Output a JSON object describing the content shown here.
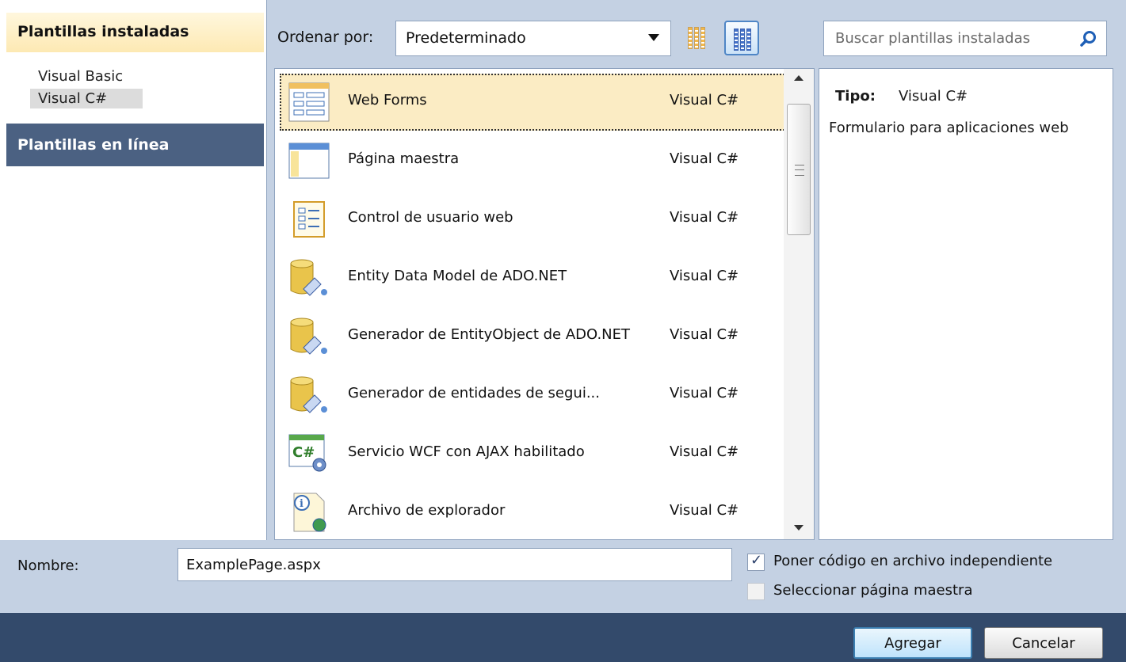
{
  "categories": {
    "installed_header": "Plantillas instaladas",
    "installed_items": [
      {
        "label": "Visual Basic",
        "selected": false
      },
      {
        "label": "Visual C#",
        "selected": true
      }
    ],
    "online_header": "Plantillas en línea"
  },
  "toolbar": {
    "sort_label": "Ordenar por:",
    "sort_value": "Predeterminado",
    "search_placeholder": "Buscar plantillas instaladas"
  },
  "templates": [
    {
      "name": "Web Forms",
      "language": "Visual C#",
      "icon": "web-form-icon",
      "selected": true
    },
    {
      "name": "Página maestra",
      "language": "Visual C#",
      "icon": "master-page-icon",
      "selected": false
    },
    {
      "name": "Control de usuario web",
      "language": "Visual C#",
      "icon": "user-control-icon",
      "selected": false
    },
    {
      "name": "Entity Data Model de ADO.NET",
      "language": "Visual C#",
      "icon": "database-icon",
      "selected": false
    },
    {
      "name": "Generador de EntityObject de ADO.NET",
      "language": "Visual C#",
      "icon": "database-icon",
      "selected": false
    },
    {
      "name": "Generador de entidades de segui...",
      "language": "Visual C#",
      "icon": "database-icon",
      "selected": false
    },
    {
      "name": "Servicio WCF con AJAX habilitado",
      "language": "Visual C#",
      "icon": "wcf-service-icon",
      "selected": false
    },
    {
      "name": "Archivo de explorador",
      "language": "Visual C#",
      "icon": "browser-file-icon",
      "selected": false
    }
  ],
  "details": {
    "type_label": "Tipo:",
    "type_value": "Visual C#",
    "description": "Formulario para aplicaciones web"
  },
  "name_row": {
    "label": "Nombre:",
    "value": "ExamplePage.aspx"
  },
  "options": [
    {
      "label": "Poner código en archivo independiente",
      "checked": true
    },
    {
      "label": "Seleccionar página maestra",
      "checked": false
    }
  ],
  "buttons": {
    "add": "Agregar",
    "cancel": "Cancelar"
  },
  "colors": {
    "dialog_background": "#c4d1e3",
    "footer_background": "#334a6b",
    "online_header_background": "#4b6182",
    "selection_highlight": "#fbecc4",
    "primary_button_border": "#3c7fb1"
  }
}
